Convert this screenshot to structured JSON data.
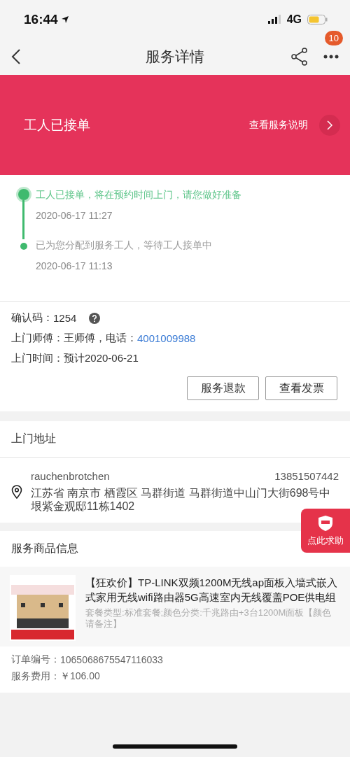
{
  "status_bar": {
    "time": "16:44",
    "network": "4G"
  },
  "nav": {
    "title": "服务详情",
    "badge": "10"
  },
  "banner": {
    "status": "工人已接单",
    "link": "查看服务说明"
  },
  "timeline": [
    {
      "text": "工人已接单，将在预约时间上门，请您做好准备",
      "time": "2020-06-17 11:27",
      "active": true
    },
    {
      "text": "已为您分配到服务工人，等待工人接单中",
      "time": "2020-06-17 11:13",
      "active": false
    }
  ],
  "info": {
    "code_label": "确认码：",
    "code": "1254",
    "worker_label": "上门师傅：",
    "worker": "王师傅，电话：",
    "phone": "4001009988",
    "time_label": "上门时间：",
    "time": "预计2020-06-21"
  },
  "buttons": [
    "服务退款",
    "查看发票"
  ],
  "address": {
    "heading": "上门地址",
    "name": "rauchenbrotchen",
    "phone": "13851507442",
    "text": "江苏省 南京市 栖霞区 马群街道 马群街道中山门大街698号中垠紫金观邸11栋1402"
  },
  "help_button": "点此求助",
  "product": {
    "heading": "服务商品信息",
    "title": "【狂欢价】TP-LINK双频1200M无线ap面板入墙式嵌入式家用无线wifi路由器5G高速室内无线覆盖POE供电组",
    "spec": "套餐类型:标准套餐;颜色分类:千兆路由+3台1200M面板【颜色请备注】"
  },
  "order": {
    "number_label": "订单编号：",
    "number": "1065068675547116033",
    "fee_label": "服务费用：",
    "fee": "￥106.00"
  }
}
